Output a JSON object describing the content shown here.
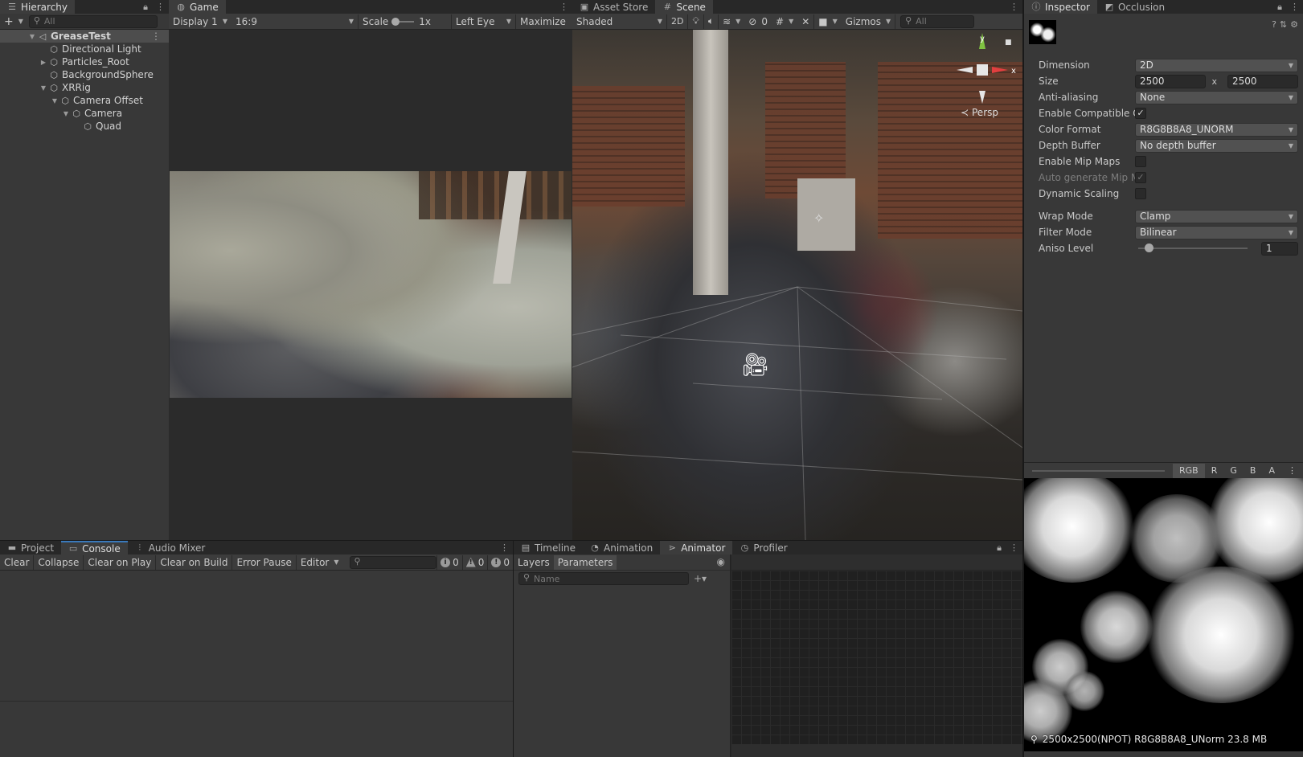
{
  "hierarchy": {
    "tab_label": "Hierarchy",
    "search_placeholder": "All",
    "items": [
      {
        "label": "GreaseTest",
        "depth": 0,
        "fold": "open",
        "icon": "unity-scene-icon"
      },
      {
        "label": "Directional Light",
        "depth": 1,
        "fold": "none",
        "icon": "gameobject-cube-icon"
      },
      {
        "label": "Particles_Root",
        "depth": 1,
        "fold": "closed",
        "icon": "gameobject-cube-icon"
      },
      {
        "label": "BackgroundSphere",
        "depth": 1,
        "fold": "none",
        "icon": "gameobject-cube-icon"
      },
      {
        "label": "XRRig",
        "depth": 1,
        "fold": "open",
        "icon": "gameobject-cube-icon"
      },
      {
        "label": "Camera Offset",
        "depth": 2,
        "fold": "open",
        "icon": "gameobject-cube-icon"
      },
      {
        "label": "Camera",
        "depth": 3,
        "fold": "open",
        "icon": "gameobject-cube-icon"
      },
      {
        "label": "Quad",
        "depth": 4,
        "fold": "none",
        "icon": "gameobject-cube-icon"
      }
    ]
  },
  "game": {
    "tab_label": "Game",
    "display": "Display 1",
    "aspect": "16:9",
    "scale_label": "Scale",
    "scale_value": "1x",
    "eye": "Left Eye",
    "maximize": "Maximize"
  },
  "scene": {
    "tabs": [
      "Asset Store",
      "Scene"
    ],
    "shading": "Shaded",
    "mode_2d": "2D",
    "hidden_count": "0",
    "gizmos": "Gizmos",
    "search_placeholder": "All",
    "axis_y": "y",
    "axis_x": "x",
    "projection": "Persp"
  },
  "inspector": {
    "tabs": [
      "Inspector",
      "Occlusion"
    ],
    "fields": {
      "dimension": {
        "label": "Dimension",
        "value": "2D"
      },
      "size": {
        "label": "Size",
        "width": "2500",
        "sep": "x",
        "height": "2500"
      },
      "anti_aliasing": {
        "label": "Anti-aliasing",
        "value": "None"
      },
      "enable_compatible": {
        "label": "Enable Compatible Co",
        "checked": "✓"
      },
      "color_format": {
        "label": "Color Format",
        "value": "R8G8B8A8_UNORM"
      },
      "depth_buffer": {
        "label": "Depth Buffer",
        "value": "No depth buffer"
      },
      "mip_maps": {
        "label": "Enable Mip Maps",
        "checked": ""
      },
      "auto_mip": {
        "label": "Auto generate Mip Ma",
        "checked": "✓"
      },
      "dynamic_scaling": {
        "label": "Dynamic Scaling",
        "checked": ""
      },
      "wrap_mode": {
        "label": "Wrap Mode",
        "value": "Clamp"
      },
      "filter_mode": {
        "label": "Filter Mode",
        "value": "Bilinear"
      },
      "aniso_level": {
        "label": "Aniso Level",
        "value": "1"
      }
    },
    "channels": [
      "RGB",
      "R",
      "G",
      "B",
      "A"
    ],
    "preview_info": "2500x2500(NPOT)  R8G8B8A8_UNorm  23.8 MB"
  },
  "console": {
    "tabs": [
      "Project",
      "Console",
      "Audio Mixer"
    ],
    "buttons": [
      "Clear",
      "Collapse",
      "Clear on Play",
      "Clear on Build",
      "Error Pause"
    ],
    "editor": "Editor",
    "counts": {
      "info": "0",
      "warning": "0",
      "error": "0"
    }
  },
  "animator": {
    "tabs": [
      "Timeline",
      "Animation",
      "Animator",
      "Profiler"
    ],
    "sections": [
      "Layers",
      "Parameters"
    ],
    "name_placeholder": "Name"
  },
  "colors": {
    "accent": "#3a79bb",
    "panel": "#383838",
    "tabbar": "#282828"
  }
}
